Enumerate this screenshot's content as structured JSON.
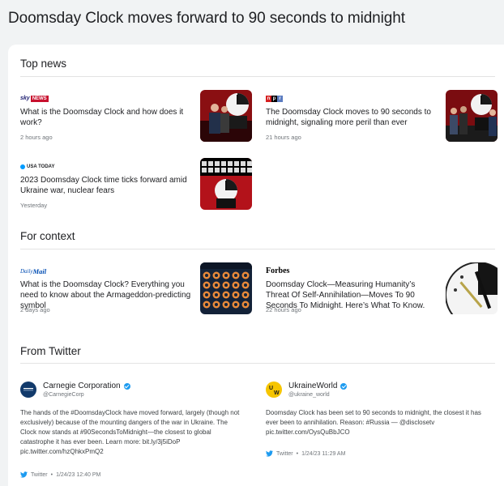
{
  "page": {
    "title": "Doomsday Clock moves forward to 90 seconds to midnight"
  },
  "sections": {
    "top_news": {
      "title": "Top news",
      "articles": [
        {
          "source_logo": "sky-news-logo",
          "source_parts": [
            "sky",
            "NEWS"
          ],
          "headline": "What is the Doomsday Clock and how does it work?",
          "time": "2 hours ago",
          "thumb": "doomsday-clock-photo"
        },
        {
          "source_logo": "npr-logo",
          "source_parts": [
            "n",
            "p",
            "r"
          ],
          "headline": "The Doomsday Clock moves to 90 seconds to midnight, signaling more peril than ever",
          "time": "21 hours ago",
          "thumb": "doomsday-clock-photo"
        },
        {
          "source_logo": "usa-today-logo",
          "source_parts": [
            "USA TODAY"
          ],
          "headline": "2023 Doomsday Clock time ticks forward amid Ukraine war, nuclear fears",
          "time": "Yesterday",
          "thumb": "doomsday-clock-photo"
        }
      ]
    },
    "for_context": {
      "title": "For context",
      "articles": [
        {
          "source_logo": "daily-mail-logo",
          "source_parts": [
            "Daily",
            "Mail"
          ],
          "headline": "What is the Doomsday Clock? Everything you need to know about the Armageddon-predicting symbol",
          "time": "2 days ago",
          "thumb": "doomsday-clock-grid"
        },
        {
          "source_logo": "forbes-logo",
          "source_parts": [
            "Forbes"
          ],
          "headline": "Doomsday Clock—Measuring Humanity’s Threat Of Self-Annihilation—Moves To 90 Seconds To Midnight. Here’s What To Know.",
          "time": "22 hours ago",
          "thumb": "clock-face-closeup"
        }
      ]
    },
    "from_twitter": {
      "title": "From Twitter",
      "tweets": [
        {
          "name": "Carnegie Corporation",
          "handle": "@CarnegieCorp",
          "avatar": "carnegie-avatar",
          "text": "The hands of the #DoomsdayClock have moved forward, largely (though not exclusively) because of the mounting dangers of the war in Ukraine. The Clock now stands at #90SecondsToMidnight—the closest to global catastrophe it has ever been. Learn more: bit.ly/3j5iDoP pic.twitter.com/hzQhkxPmQ2",
          "platform": "Twitter",
          "timestamp": "1/24/23 12:40 PM"
        },
        {
          "name": "UkraineWorld",
          "handle": "@ukraine_world",
          "avatar": "ukraineworld-avatar",
          "text": "Doomsday Clock has been set to 90 seconds to midnight, the closest it has ever been to annihilation. Reason: #Russia — @disclosetv pic.twitter.com/OysQuBbJCO",
          "platform": "Twitter",
          "timestamp": "1/24/23 11:29 AM"
        }
      ]
    }
  },
  "colors": {
    "background": "#f1f3f4",
    "card": "#ffffff",
    "twitter_blue": "#1d9bf0",
    "secondary_text": "#70757a",
    "sky_news_red": "#c8102e",
    "npr_red": "#d62021",
    "npr_black": "#000000",
    "npr_blue": "#5a7bc0",
    "usa_today_blue": "#009bff",
    "daily_mail_blue": "#004db3"
  }
}
